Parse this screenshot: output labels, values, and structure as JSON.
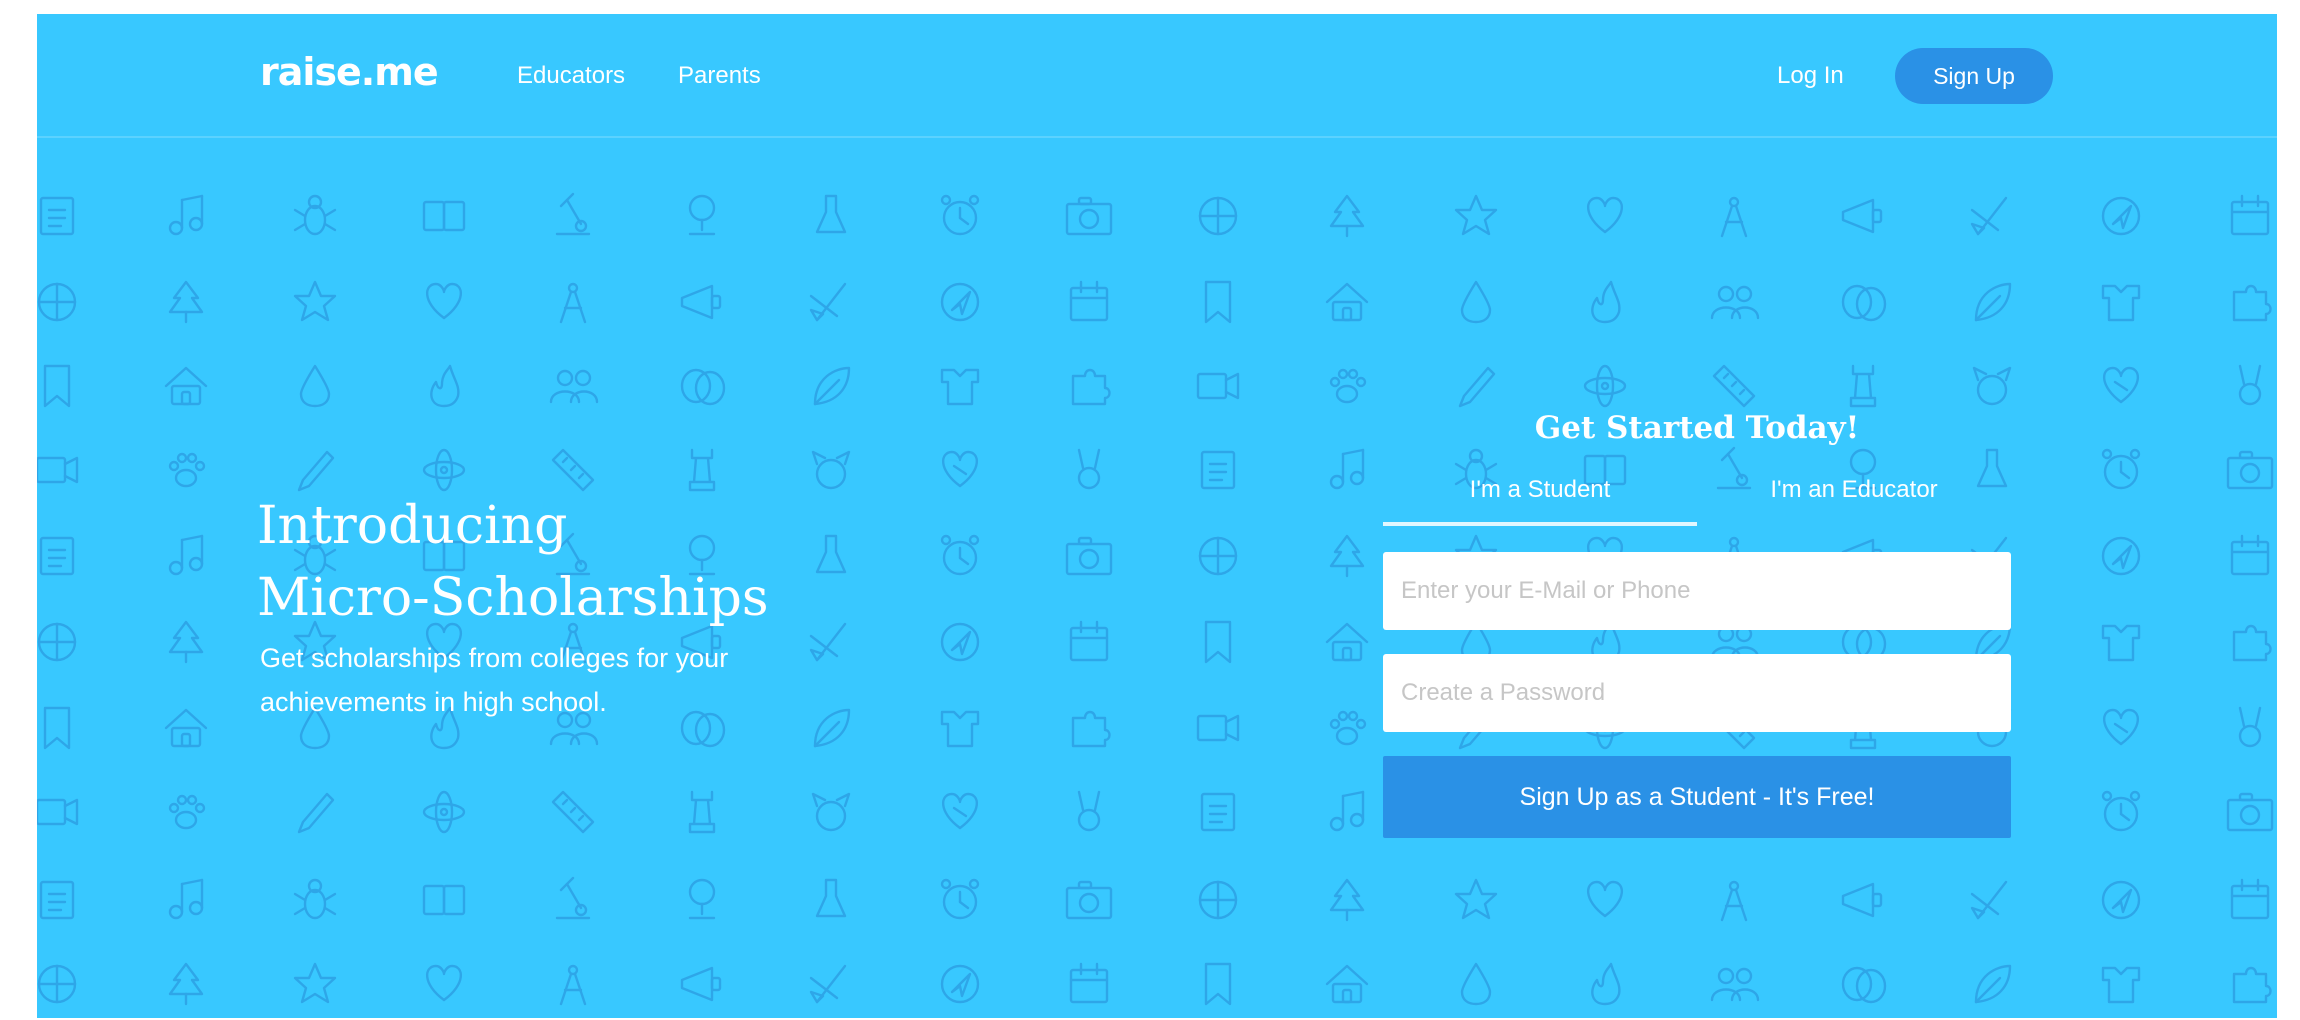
{
  "header": {
    "logo": "raise.me",
    "nav": {
      "educators": "Educators",
      "parents": "Parents"
    },
    "login": "Log In",
    "signup": "Sign Up"
  },
  "hero": {
    "title_line1": "Introducing",
    "title_line2": "Micro-Scholarships",
    "subtitle": "Get scholarships from colleges for your achievements in high school."
  },
  "signup_form": {
    "title": "Get Started Today!",
    "tabs": {
      "student": "I'm a Student",
      "educator": "I'm an Educator"
    },
    "active_tab": "student",
    "email_placeholder": "Enter your E-Mail or Phone",
    "password_placeholder": "Create a Password",
    "submit": "Sign Up as a Student - It's Free!"
  },
  "background_pattern": {
    "icons": [
      "notepad-icon",
      "music-note-icon",
      "bug-icon",
      "book-icon",
      "microscope-icon",
      "trophy-icon",
      "flask-icon",
      "alarm-clock-icon",
      "camera-icon",
      "basketball-icon",
      "tree-icon",
      "star-icon",
      "heart-icon",
      "compass-icon",
      "megaphone-icon",
      "paintbrush-icon",
      "navigation-icon",
      "calendar-icon",
      "bookmark-icon",
      "house-icon",
      "drop-icon",
      "flame-icon",
      "people-icon",
      "theater-masks-icon",
      "leaf-icon",
      "jersey-icon",
      "puzzle-icon",
      "video-camera-icon",
      "paw-icon",
      "pencil-icon",
      "atom-icon",
      "ruler-icon",
      "chess-rook-icon",
      "dog-face-icon",
      "heart-badge-icon",
      "medal-icon"
    ]
  },
  "colors": {
    "background": "#38c8ff",
    "icon_stroke": "#2ea6e8",
    "accent_button": "#2a91e6",
    "text": "#ffffff"
  }
}
